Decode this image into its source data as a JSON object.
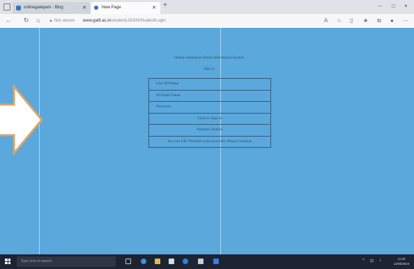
{
  "browser": {
    "tabs": [
      {
        "label": "onlinegatepam - Bing",
        "active": false
      },
      {
        "label": "New Page",
        "active": true
      }
    ],
    "new_tab": "+",
    "window_controls": [
      "–",
      "□",
      "×"
    ],
    "address": {
      "security": "Not secure",
      "host": "www.gatfi.ac.in",
      "path": "/studentLOGIN/Student/Login"
    }
  },
  "page": {
    "background": "#5aa8dc",
    "title": "Online Admission Portal Information System",
    "subtitle": "Sign in",
    "form": {
      "user_id_label": "User ID/Name",
      "email_label": "ID Email Name",
      "password_label": "Password",
      "login_button": "Click to Sign In",
      "register_button": "Register Student",
      "footer_link": "Are you OK? Problem with your Info. Please Continue"
    }
  },
  "taskbar": {
    "search_placeholder": "Type here to search",
    "clock_time": "11:20",
    "clock_date": "12/05/2024"
  },
  "colors": {
    "accent": "#5aa8dc",
    "taskbar": "#1c2433",
    "arrow_fill": "#ffffff",
    "arrow_stroke": "#d9a36b"
  }
}
